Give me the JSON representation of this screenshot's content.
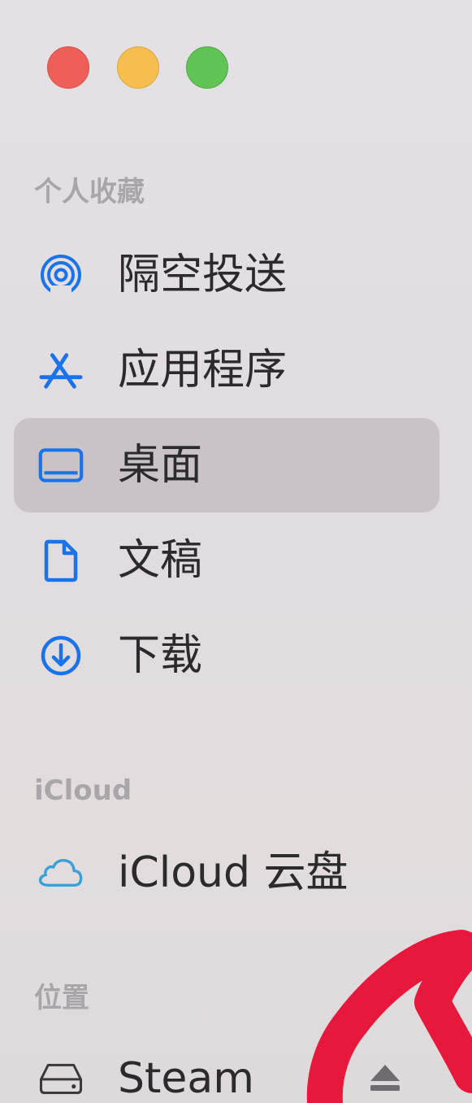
{
  "window_controls": {
    "close": "close-button",
    "minimize": "minimize-button",
    "zoom": "zoom-button"
  },
  "sections": {
    "favorites": "个人收藏",
    "icloud": "iCloud",
    "locations": "位置"
  },
  "favorites_items": [
    {
      "label": "隔空投送",
      "icon": "airdrop-icon"
    },
    {
      "label": "应用程序",
      "icon": "applications-icon"
    },
    {
      "label": "桌面",
      "icon": "desktop-icon",
      "selected": true
    },
    {
      "label": "文稿",
      "icon": "document-icon"
    },
    {
      "label": "下载",
      "icon": "downloads-icon"
    }
  ],
  "icloud_items": [
    {
      "label": "iCloud 云盘",
      "icon": "cloud-icon"
    }
  ],
  "location_items": [
    {
      "label": "Steam",
      "icon": "disk-icon",
      "eject_icon": "eject-icon"
    }
  ],
  "colors": {
    "sidebar_bg": "#e2dee2",
    "selected_bg": "#c9c3c8",
    "accent_blue": "#1a73e8",
    "icloud_blue": "#3aa0d8",
    "scribble_red": "#e8173c"
  }
}
